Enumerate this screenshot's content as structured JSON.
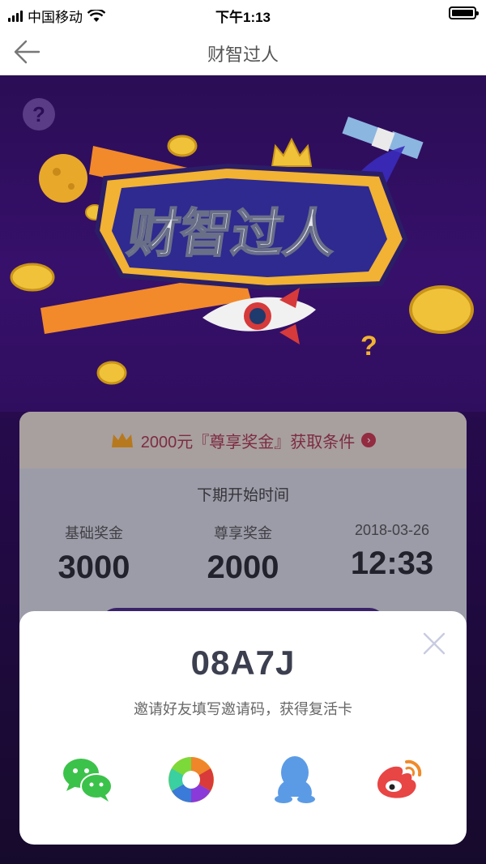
{
  "status_bar": {
    "carrier": "中国移动",
    "time": "下午1:13"
  },
  "nav": {
    "title": "财智过人"
  },
  "hero": {
    "logo_text": "财智过人"
  },
  "card": {
    "banner_text": "2000元『尊享奖金』获取条件",
    "next_period_label": "下期开始时间",
    "stats": [
      {
        "label": "基础奖金",
        "value": "3000"
      },
      {
        "label": "尊享奖金",
        "value": "2000"
      },
      {
        "label": "2018-03-26",
        "value": "12:33"
      }
    ]
  },
  "share_sheet": {
    "code": "08A7J",
    "hint": "邀请好友填写邀请码，获得复活卡",
    "targets": [
      "wechat-icon",
      "moments-icon",
      "qq-icon",
      "weibo-icon"
    ]
  },
  "colors": {
    "accent": "#c0394f",
    "bg": "#2a0d55"
  }
}
